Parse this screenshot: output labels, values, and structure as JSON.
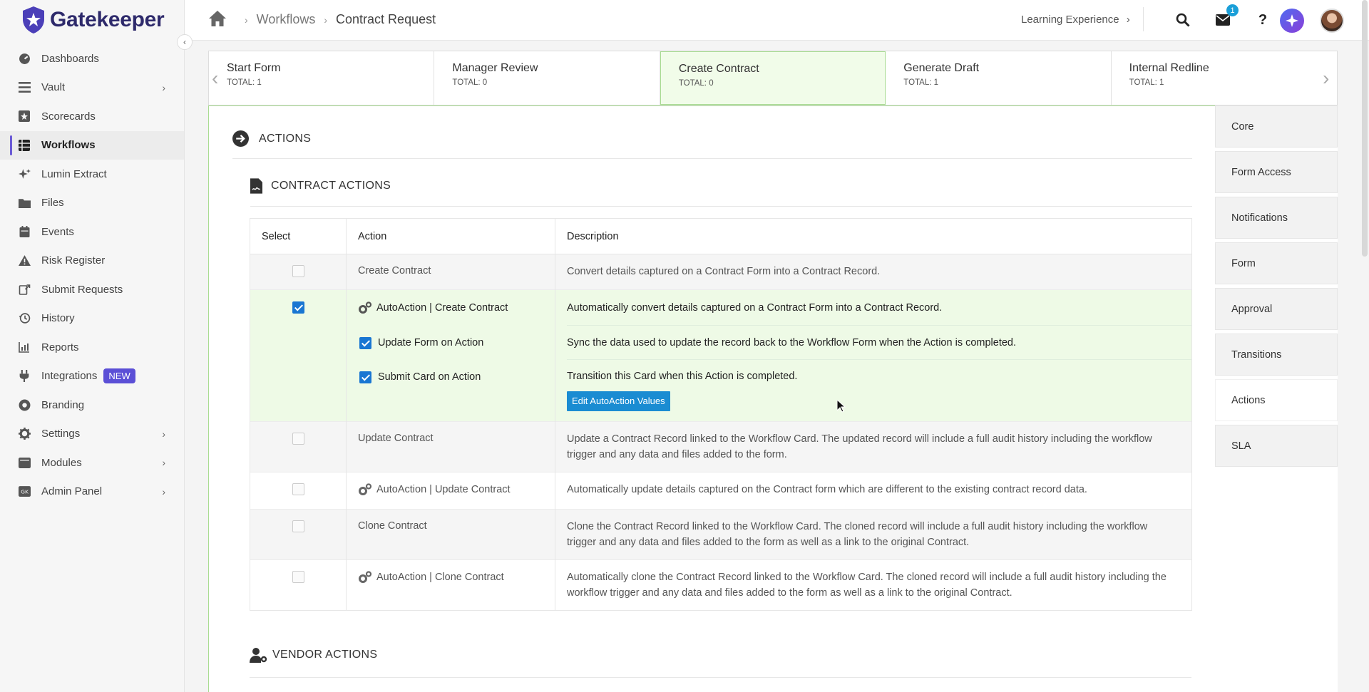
{
  "brand": {
    "name": "Gatekeeper"
  },
  "sidebar": {
    "items": [
      {
        "label": "Dashboards",
        "icon": "dashboard-icon",
        "chevron": false,
        "active": false
      },
      {
        "label": "Vault",
        "icon": "vault-icon",
        "chevron": true,
        "active": false
      },
      {
        "label": "Scorecards",
        "icon": "scorecard-icon",
        "chevron": false,
        "active": false
      },
      {
        "label": "Workflows",
        "icon": "workflow-icon",
        "chevron": false,
        "active": true
      },
      {
        "label": "Lumin Extract",
        "icon": "sparkle-icon",
        "chevron": false,
        "active": false
      },
      {
        "label": "Files",
        "icon": "files-icon",
        "chevron": false,
        "active": false
      },
      {
        "label": "Events",
        "icon": "calendar-icon",
        "chevron": false,
        "active": false
      },
      {
        "label": "Risk Register",
        "icon": "warning-icon",
        "chevron": false,
        "active": false
      },
      {
        "label": "Submit Requests",
        "icon": "submit-icon",
        "chevron": false,
        "active": false
      },
      {
        "label": "History",
        "icon": "history-icon",
        "chevron": false,
        "active": false
      },
      {
        "label": "Reports",
        "icon": "reports-icon",
        "chevron": false,
        "active": false
      },
      {
        "label": "Integrations",
        "icon": "plug-icon",
        "chevron": false,
        "active": false,
        "badge": "NEW"
      },
      {
        "label": "Branding",
        "icon": "palette-icon",
        "chevron": false,
        "active": false
      },
      {
        "label": "Settings",
        "icon": "gear-icon",
        "chevron": true,
        "active": false
      },
      {
        "label": "Modules",
        "icon": "modules-icon",
        "chevron": true,
        "active": false
      },
      {
        "label": "Admin Panel",
        "icon": "admin-icon",
        "chevron": true,
        "active": false
      }
    ]
  },
  "header": {
    "breadcrumbs": [
      "Workflows",
      "Contract Request"
    ],
    "learning": "Learning Experience",
    "notification_count": "1"
  },
  "stages": [
    {
      "name": "Start Form",
      "total": "TOTAL: 1"
    },
    {
      "name": "Manager Review",
      "total": "TOTAL: 0"
    },
    {
      "name": "Create Contract",
      "total": "TOTAL: 0"
    },
    {
      "name": "Generate Draft",
      "total": "TOTAL: 1"
    },
    {
      "name": "Internal Redline",
      "total": "TOTAL: 1"
    }
  ],
  "main": {
    "section_title": "ACTIONS",
    "contract_title": "CONTRACT ACTIONS",
    "vendor_title": "VENDOR ACTIONS",
    "columns": {
      "select": "Select",
      "action": "Action",
      "description": "Description"
    },
    "rows": [
      {
        "action": "Create Contract",
        "description": "Convert details captured on a Contract Form into a Contract Record."
      },
      {
        "action": "AutoAction | Create Contract",
        "description": "Automatically convert details captured on a Contract Form into a Contract Record."
      },
      {
        "action": "Update Contract",
        "description": "Update a Contract Record linked to the Workflow Card. The updated record will include a full audit history including the workflow trigger and any data and files added to the form."
      },
      {
        "action": "AutoAction | Update Contract",
        "description": "Automatically update details captured on the Contract form which are different to the existing contract record data."
      },
      {
        "action": "Clone Contract",
        "description": "Clone the Contract Record linked to the Workflow Card. The cloned record will include a full audit history including the workflow trigger and any data and files added to the form as well as a link to the original Contract."
      },
      {
        "action": "AutoAction | Clone Contract",
        "description": "Automatically clone the Contract Record linked to the Workflow Card. The cloned record will include a full audit history including the workflow trigger and any data and files added to the form as well as a link to the original Contract."
      }
    ],
    "suboptions": [
      {
        "label": "Update Form on Action",
        "description": "Sync the data used to update the record back to the Workflow Form when the Action is completed."
      },
      {
        "label": "Submit Card on Action",
        "description": "Transition this Card when this Action is completed."
      }
    ],
    "edit_button": "Edit AutoAction Values"
  },
  "right_menu": {
    "items": [
      "Core",
      "Form Access",
      "Notifications",
      "Form",
      "Approval",
      "Transitions",
      "Actions",
      "SLA"
    ],
    "active": "Actions"
  }
}
